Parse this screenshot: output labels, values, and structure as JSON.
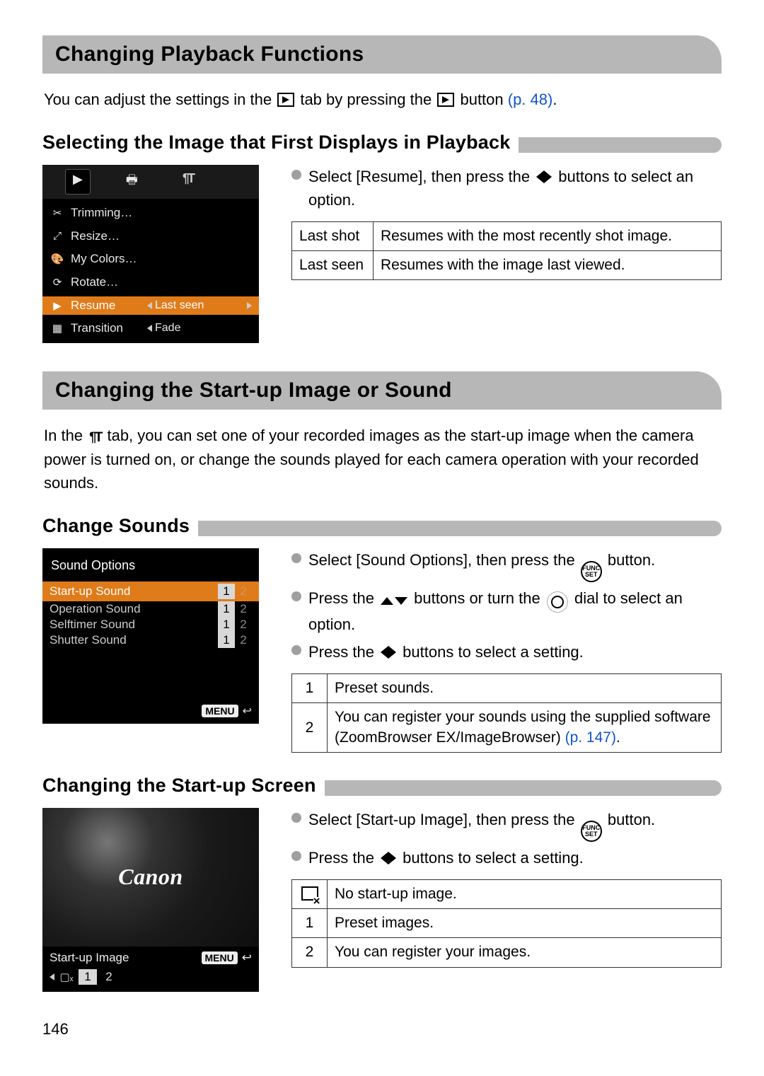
{
  "h1a": "Changing Playback Functions",
  "intro1_a": "You can adjust the settings in the ",
  "intro1_b": " tab by pressing the ",
  "intro1_c": " button ",
  "intro1_ref": "(p. 48)",
  "intro1_d": ".",
  "h2a": "Selecting the Image that First Displays in Playback",
  "bul1": "Select [Resume], then press the ",
  "bul1_b": " buttons to select an option.",
  "table1": {
    "r1c1": "Last shot",
    "r1c2": "Resumes with the most recently shot image.",
    "r2c1": "Last seen",
    "r2c2": "Resumes with the image last viewed."
  },
  "cam1": {
    "tab_play": "▶",
    "tab_print": "🖶",
    "tab_tools": "¶†",
    "rows": [
      {
        "lbl": "Trimming…"
      },
      {
        "lbl": "Resize…"
      },
      {
        "lbl": "My Colors…"
      },
      {
        "lbl": "Rotate…"
      },
      {
        "lbl": "Resume",
        "val": "Last seen",
        "sel": true
      },
      {
        "lbl": "Transition",
        "val": "Fade"
      }
    ]
  },
  "h1b": "Changing the Start-up Image or Sound",
  "intro2_a": "In the ",
  "intro2_b": " tab, you can set one of your recorded images as the start-up image when the camera power is turned on, or change the sounds played for each camera operation with your recorded sounds.",
  "h2b": "Change Sounds",
  "bul2a_a": "Select [Sound Options], then press the ",
  "bul2a_b": " button.",
  "bul2b_a": "Press the ",
  "bul2b_b": " buttons or turn the ",
  "bul2b_c": " dial to select an option.",
  "bul2c_a": "Press the ",
  "bul2c_b": " buttons to select a setting.",
  "table2": {
    "r1c1": "1",
    "r1c2": "Preset sounds.",
    "r2c1": "2",
    "r2c2_a": "You can register your sounds using the supplied software (ZoomBrowser EX/ImageBrowser) ",
    "r2c2_ref": "(p. 147)",
    "r2c2_b": "."
  },
  "cam2": {
    "title": "Sound Options",
    "rows": [
      {
        "lbl": "Start-up Sound",
        "opts": [
          "1",
          "2"
        ],
        "sel": 0,
        "first": true
      },
      {
        "lbl": "Operation Sound",
        "opts": [
          "1",
          "2"
        ],
        "sel": 0
      },
      {
        "lbl": "Selftimer Sound",
        "opts": [
          "1",
          "2"
        ],
        "sel": 0
      },
      {
        "lbl": "Shutter Sound",
        "opts": [
          "1",
          "2"
        ],
        "sel": 0
      }
    ],
    "menu": "MENU",
    "back": "↩"
  },
  "h2c": "Changing the Start-up Screen",
  "bul3a_a": "Select [Start-up Image], then press the ",
  "bul3a_b": " button.",
  "bul3b_a": "Press the ",
  "bul3b_b": " buttons to select a setting.",
  "table3": {
    "r1c2": "No start-up image.",
    "r2c1": "1",
    "r2c2": "Preset images.",
    "r3c1": "2",
    "r3c2": "You can register your images."
  },
  "cam3": {
    "brand": "Canon",
    "label": "Start-up Image",
    "menu": "MENU",
    "back": "↩",
    "opts": [
      "▢ₓ",
      "1",
      "2"
    ],
    "sel": 1
  },
  "func_label": "FUNC\nSET",
  "page_number": "146"
}
